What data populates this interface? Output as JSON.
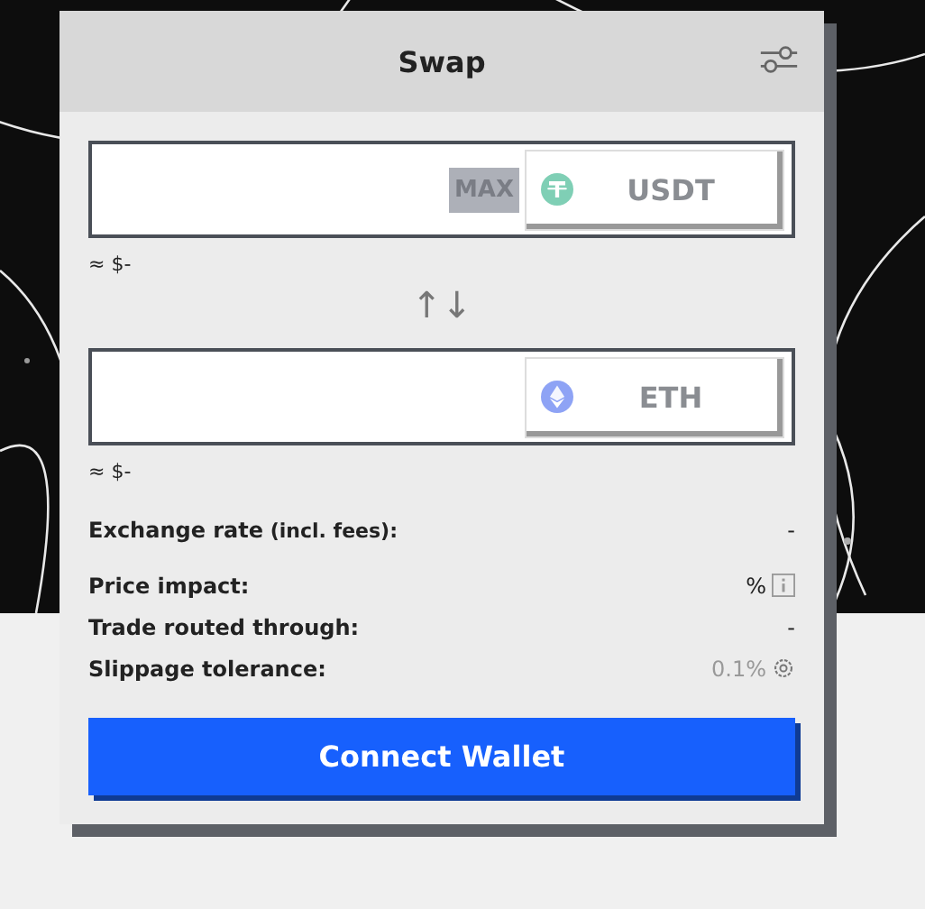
{
  "header": {
    "title": "Swap"
  },
  "fields": [
    {
      "max_label": "MAX",
      "token": {
        "symbol": "USDT",
        "kind": "tether",
        "color": "#7fcfb5"
      },
      "usd": "≈ $-"
    },
    {
      "token": {
        "symbol": "ETH",
        "kind": "eth",
        "color": "#8ea3f5"
      },
      "usd": "≈ $-"
    }
  ],
  "switch": {
    "glyph": "↑↓"
  },
  "details": [
    {
      "kind": "plain",
      "label": "Exchange rate",
      "note": "(incl. fees):",
      "value": "-"
    },
    {
      "kind": "info",
      "label": "Price impact:",
      "value": "%"
    },
    {
      "kind": "plain",
      "label": "Trade routed through:",
      "value": "-"
    },
    {
      "kind": "setting",
      "label": "Slippage tolerance:",
      "value": "0.1%"
    }
  ],
  "action": {
    "label": "Connect Wallet"
  }
}
